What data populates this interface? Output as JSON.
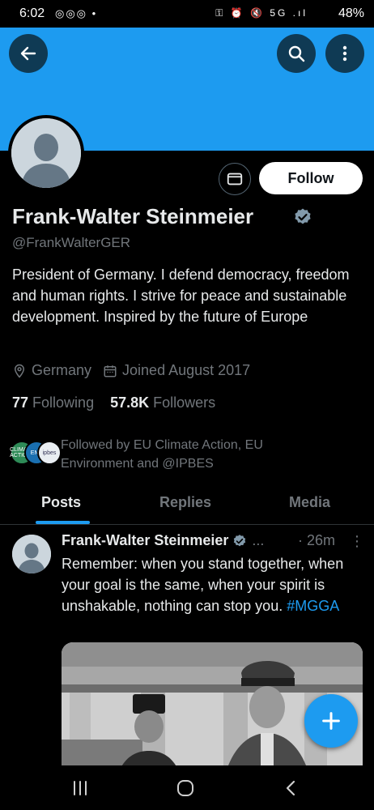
{
  "status_bar": {
    "time": "6:02",
    "left_icons": "◎◎◎ •",
    "right_icons": "⚿ ⏰ 🔇 5G .ıl",
    "battery": "48%"
  },
  "header": {
    "back_icon": "arrow-left-icon",
    "search_icon": "search-icon",
    "more_icon": "more-vertical-icon",
    "banner_color": "#1d9bf0"
  },
  "profile": {
    "name": "Frank-Walter Steinmeier",
    "handle": "@FrankWalterGER",
    "bio": "President of Germany. I defend democracy, freedom and human rights. I strive for peace and sustainable development. Inspired by the future of Europe",
    "location": "Germany",
    "joined": "Joined August 2017",
    "following_count": "77",
    "following_label": "Following",
    "followers_count": "57.8K",
    "followers_label": "Followers",
    "follow_button": "Follow",
    "followed_by": "Followed by EU Climate Action, EU Environment and @IPBES"
  },
  "followed_avatars": [
    "CLIMATE ACTION",
    "ENV",
    "ipbes"
  ],
  "tabs": [
    {
      "label": "Posts",
      "active": true
    },
    {
      "label": "Replies",
      "active": false
    },
    {
      "label": "Media",
      "active": false
    }
  ],
  "post": {
    "author": "Frank-Walter Steinmeier",
    "ellipsis": "...",
    "time": "· 26m",
    "more": "⋮",
    "text": "Remember: when you stand together, when your goal is the same, when your spirit is unshakable, nothing can stop you.",
    "hashtag": "#MGGA"
  },
  "fab_icon": "plus-icon",
  "nav": {
    "recents_icon": "recent-apps-icon",
    "home_icon": "home-icon",
    "back_icon": "back-chevron-icon"
  },
  "colors": {
    "accent": "#1d9bf0",
    "background": "#000000",
    "text_primary": "#e7e9ea",
    "text_secondary": "#71767b"
  }
}
